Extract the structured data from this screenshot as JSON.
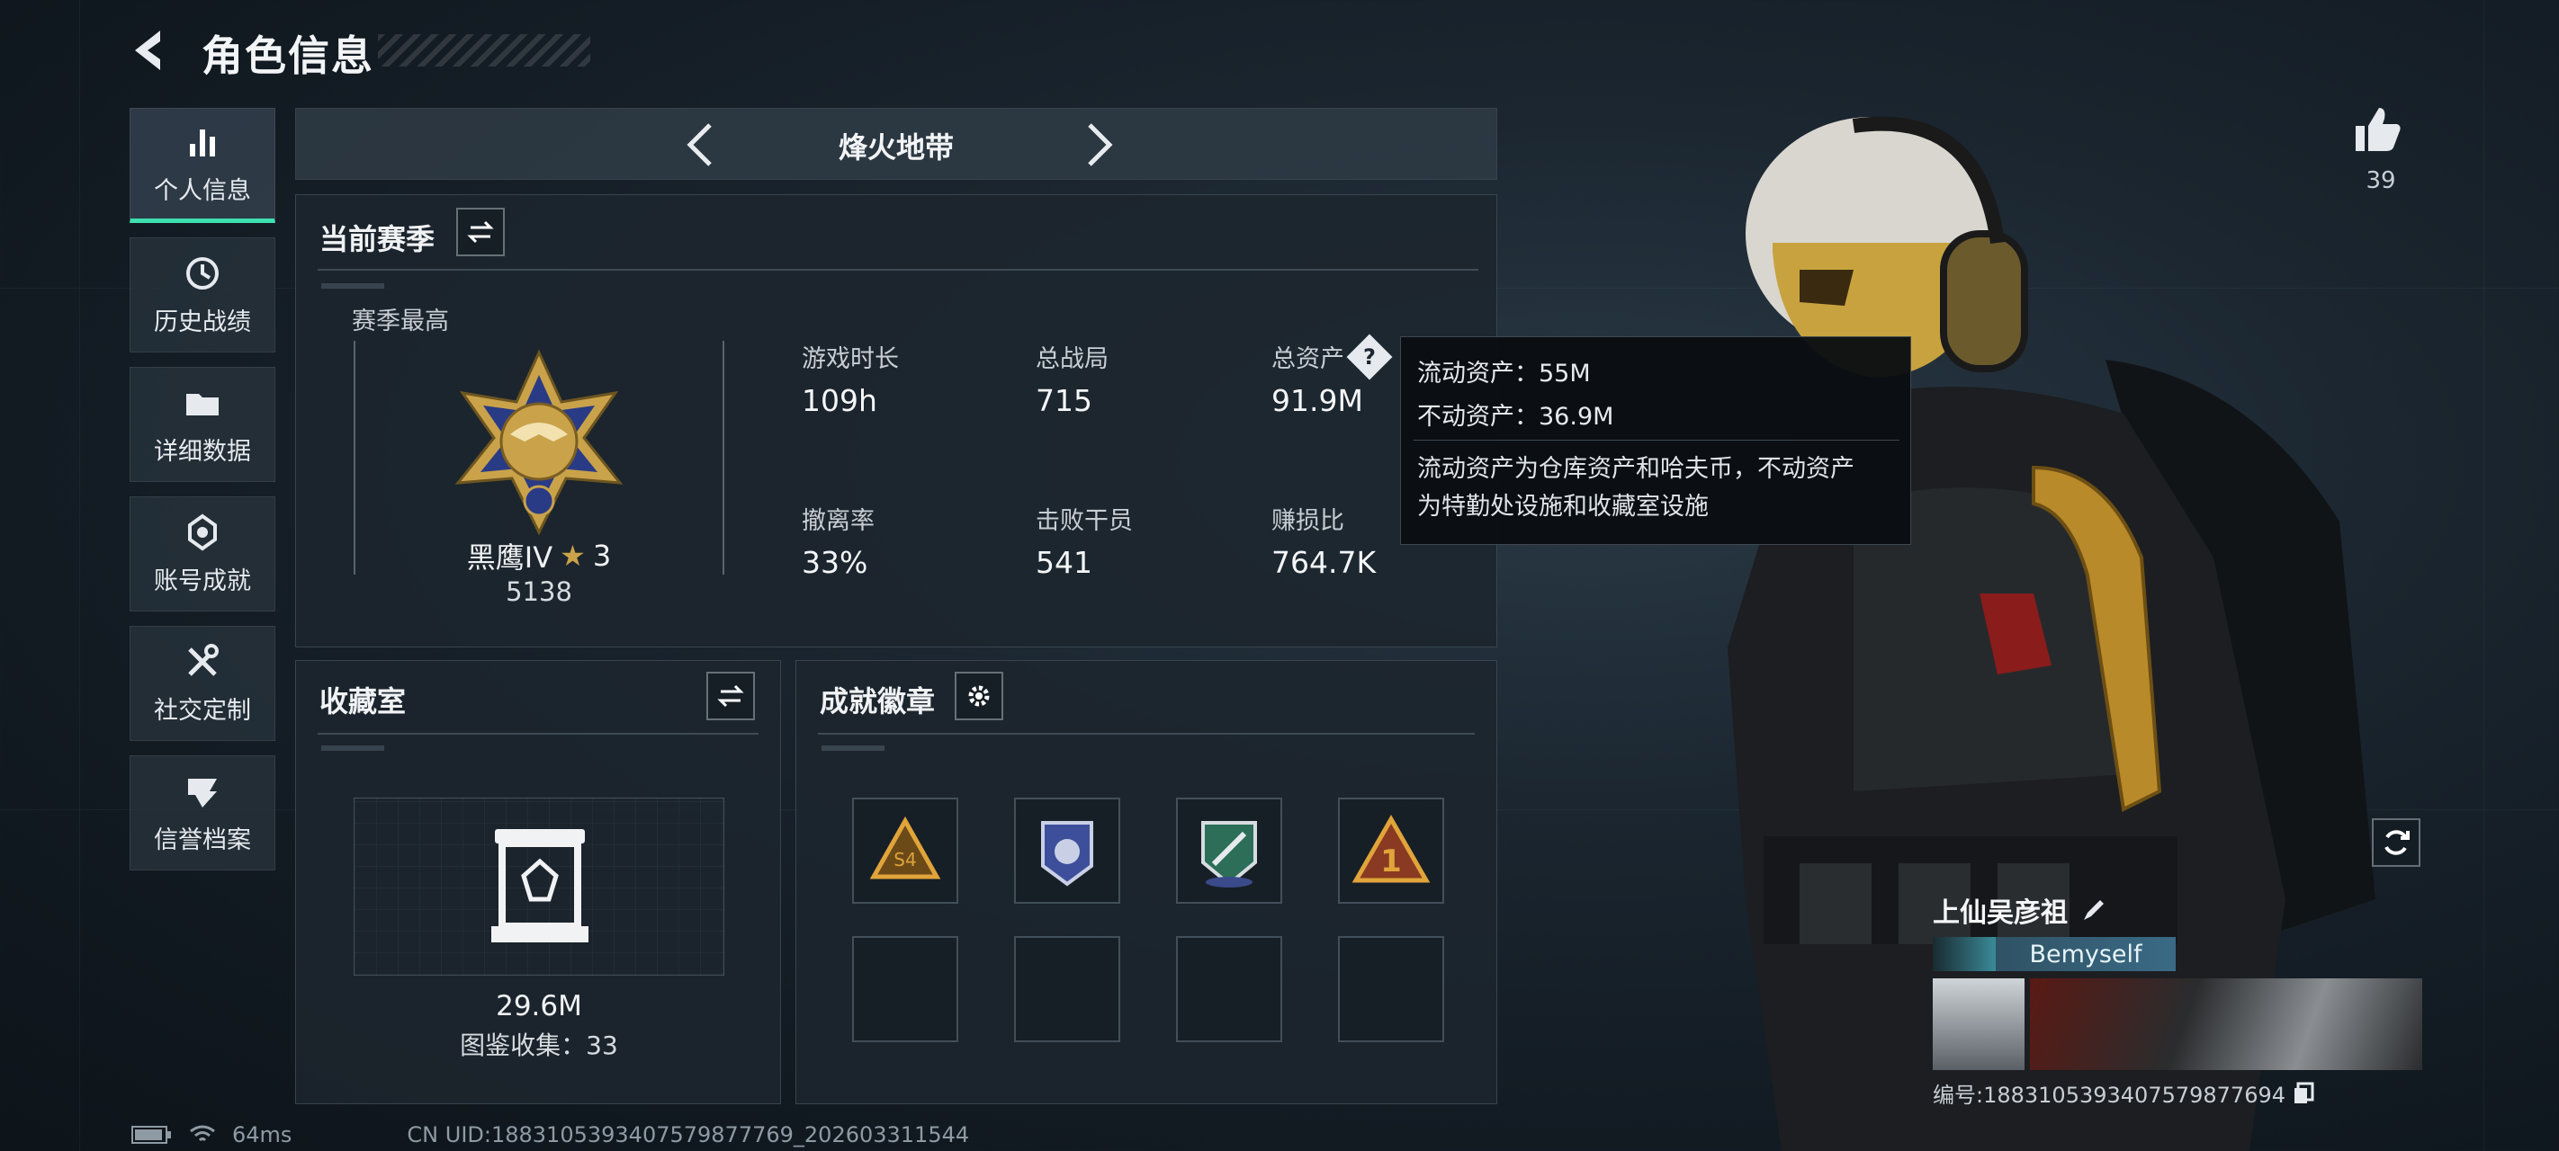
{
  "header": {
    "title": "角色信息"
  },
  "sidebar": {
    "items": [
      {
        "label": "个人信息",
        "icon": "bar-chart-icon",
        "active": true
      },
      {
        "label": "历史战绩",
        "icon": "history-clock-icon",
        "active": false
      },
      {
        "label": "详细数据",
        "icon": "folder-icon",
        "active": false
      },
      {
        "label": "账号成就",
        "icon": "achievement-icon",
        "active": false
      },
      {
        "label": "社交定制",
        "icon": "tools-icon",
        "active": false
      },
      {
        "label": "信誉档案",
        "icon": "shield-badge-icon",
        "active": false
      }
    ]
  },
  "mode": {
    "title": "烽火地带"
  },
  "season": {
    "title": "当前赛季",
    "best_label": "赛季最高",
    "rank_name": "黑鹰IV",
    "rank_stars": "3",
    "rank_points": "5138",
    "stats": [
      {
        "label": "游戏时长",
        "value": "109h"
      },
      {
        "label": "总战局",
        "value": "715"
      },
      {
        "label": "总资产",
        "value": "91.9M"
      },
      {
        "label": "撤离率",
        "value": "33%"
      },
      {
        "label": "击败干员",
        "value": "541"
      },
      {
        "label": "赚损比",
        "value": "764.7K"
      }
    ]
  },
  "tooltip": {
    "liquid": "流动资产：55M",
    "fixed": "不动资产：36.9M",
    "desc_line1": "流动资产为仓库资产和哈夫币，不动资产",
    "desc_line2": "为特勤处设施和收藏室设施"
  },
  "collection": {
    "title": "收藏室",
    "value": "29.6M",
    "count_text": "图鉴收集：33"
  },
  "achievements": {
    "title": "成就徽章",
    "badges": [
      "badge-s4-icon",
      "badge-police-icon",
      "badge-green-shield-icon",
      "badge-rank-one-icon"
    ],
    "empty_slots": 4
  },
  "likes": {
    "count": "39"
  },
  "profile": {
    "name": "上仙吴彦祖",
    "tag": "Bemyself",
    "id_text": "编号:1883105393407579877694"
  },
  "status": {
    "ping": "64ms",
    "uid": "CN UID:1883105393407579877769_202603311544"
  },
  "colors": {
    "accent": "#3ee0b0",
    "gold": "#c9a24a",
    "panel": "#1c262e"
  }
}
